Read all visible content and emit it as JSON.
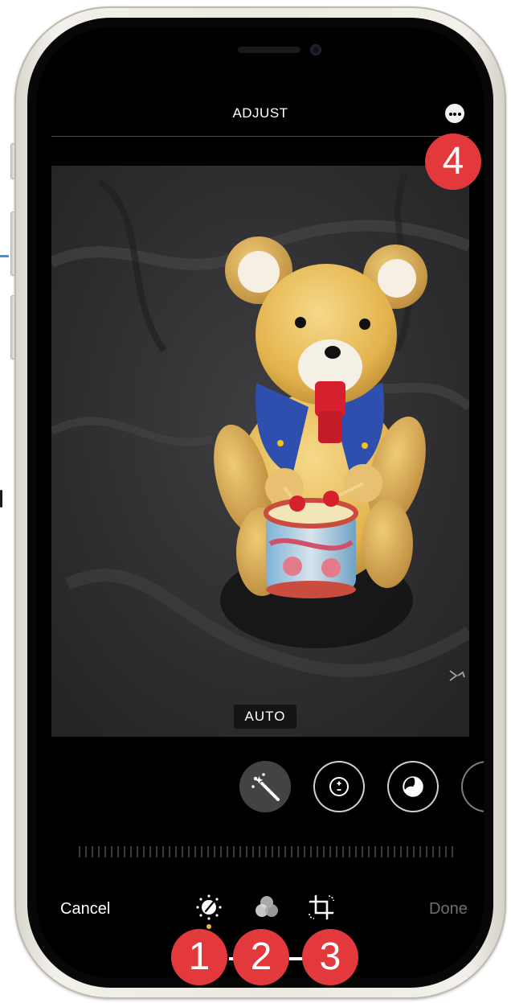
{
  "header": {
    "title": "ADJUST"
  },
  "photo": {
    "auto_label": "AUTO",
    "subject": "teddy bear with drum"
  },
  "tools": [
    {
      "icon": "magic-wand-icon",
      "selected": true
    },
    {
      "icon": "exposure-icon",
      "selected": false
    },
    {
      "icon": "brilliance-icon",
      "selected": false
    }
  ],
  "bottom_bar": {
    "cancel_label": "Cancel",
    "done_label": "Done",
    "tabs": [
      {
        "icon": "adjust-dial-icon",
        "active": true
      },
      {
        "icon": "filters-icon",
        "active": false
      },
      {
        "icon": "crop-icon",
        "active": false
      }
    ]
  },
  "callouts": [
    {
      "label": "1"
    },
    {
      "label": "2"
    },
    {
      "label": "3"
    },
    {
      "label": "4"
    }
  ],
  "colors": {
    "callout": "#e4393c",
    "active_tab_dot": "#f4b73e",
    "screen_background": "#000000"
  }
}
